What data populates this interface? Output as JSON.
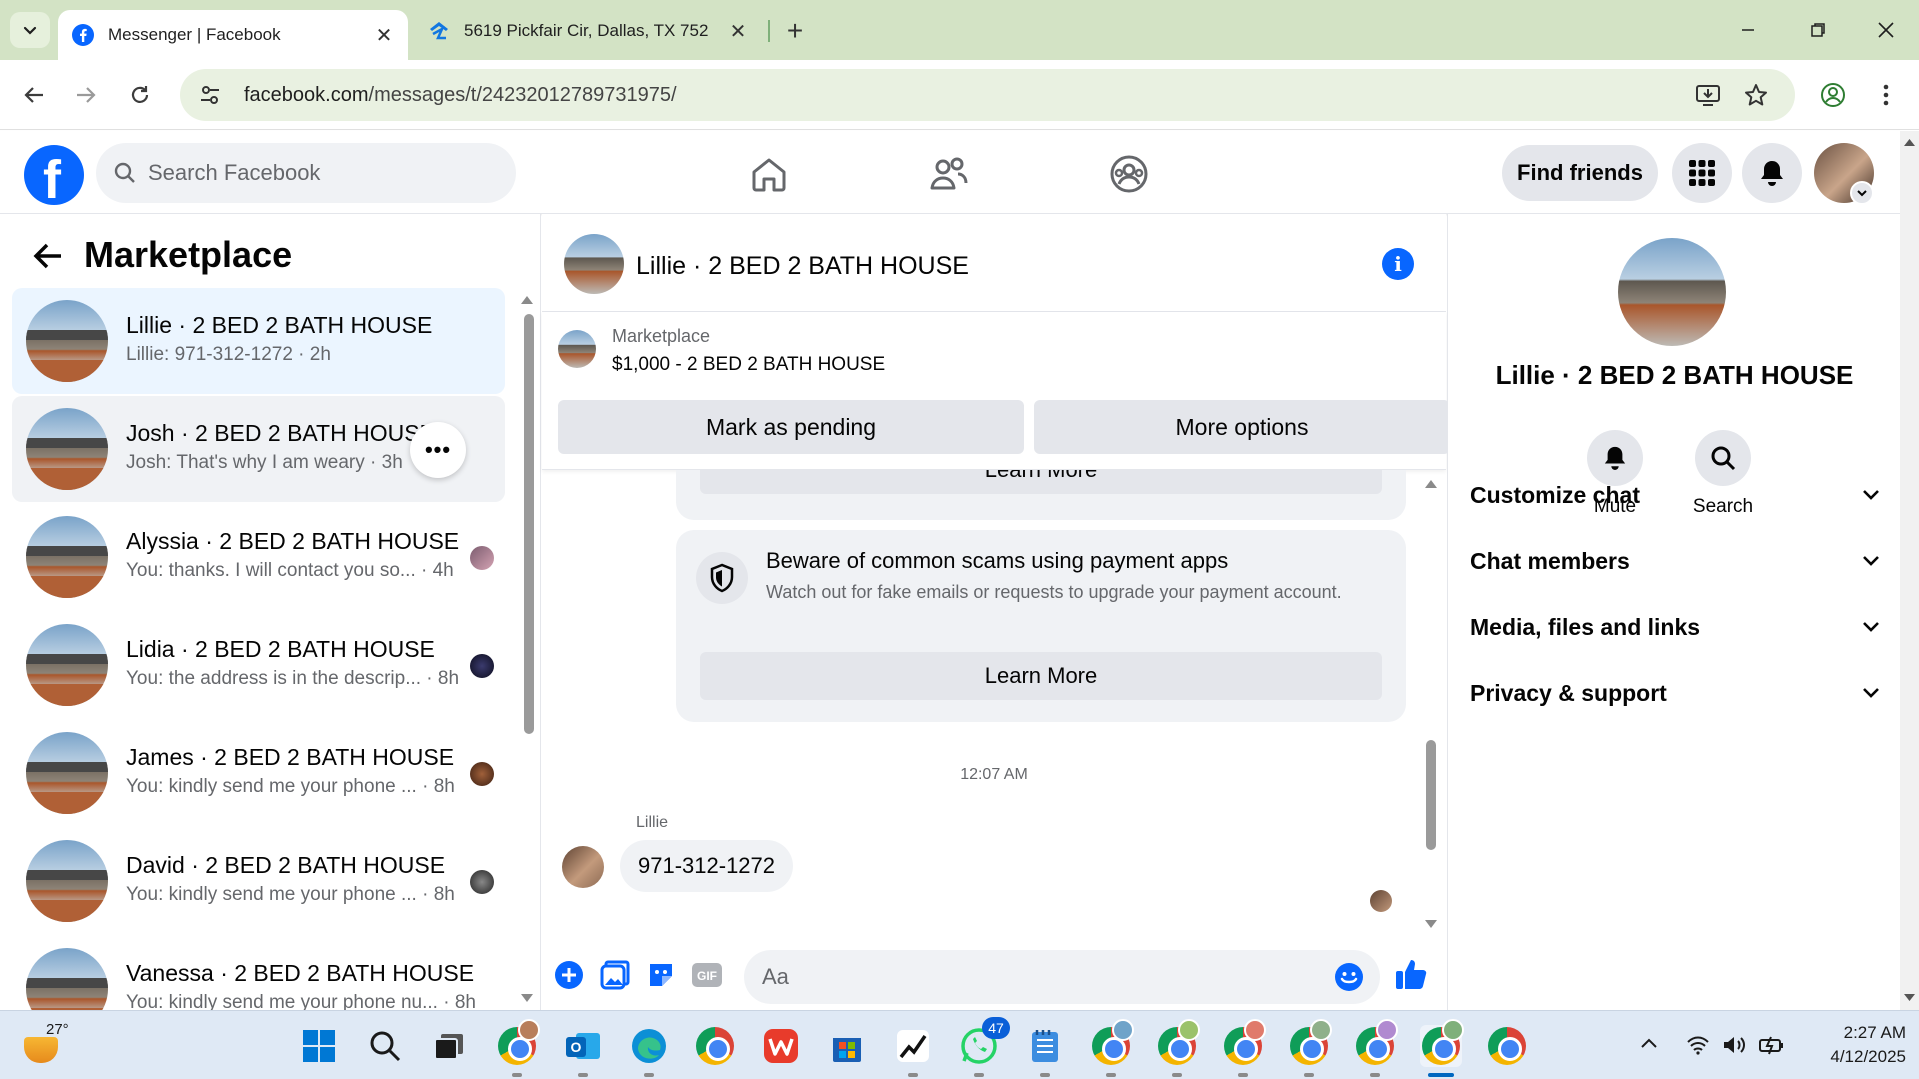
{
  "browser": {
    "tabs": [
      {
        "title": "Messenger | Facebook",
        "icon": "facebook-icon",
        "active": true
      },
      {
        "title": "5619 Pickfair Cir, Dallas, TX 752",
        "icon": "zillow-icon",
        "active": false
      }
    ],
    "url_host": "facebook.com",
    "url_path": "/messages/t/24232012789731975/"
  },
  "fb_header": {
    "search_placeholder": "Search Facebook",
    "find_friends_label": "Find friends"
  },
  "left_panel": {
    "title": "Marketplace",
    "conversations": [
      {
        "name": "Lillie · 2 BED 2 BATH HOUSE",
        "preview": "Lillie: 971-312-1272 · 2h",
        "state": "selected"
      },
      {
        "name": "Josh · 2 BED 2 BATH HOUSE",
        "preview": "Josh: That's why I am weary · 3h",
        "state": "hovered"
      },
      {
        "name": "Alyssia · 2 BED 2 BATH HOUSE",
        "preview": "You: thanks. I will contact you so... · 4h"
      },
      {
        "name": "Lidia · 2 BED 2 BATH HOUSE",
        "preview": "You: the address is in the descrip... · 8h"
      },
      {
        "name": "James · 2 BED 2 BATH HOUSE",
        "preview": "You: kindly send me your phone ... · 8h"
      },
      {
        "name": "David · 2 BED 2 BATH HOUSE",
        "preview": "You: kindly send me your phone ... · 8h"
      },
      {
        "name": "Vanessa · 2 BED 2 BATH HOUSE",
        "preview": "You: kindly send me your phone nu... · 8h"
      }
    ],
    "more_label": "•••"
  },
  "chat": {
    "title": "Lillie · 2 BED 2 BATH HOUSE",
    "marketplace_label": "Marketplace",
    "listing": "$1,000 - 2 BED 2 BATH HOUSE",
    "mark_pending_label": "Mark as pending",
    "more_options_label": "More options",
    "learn_more_label": "Learn More",
    "scam_title": "Beware of common scams using payment apps",
    "scam_desc": "Watch out for fake emails or requests to upgrade your payment account.",
    "timestamp": "12:07 AM",
    "sender": "Lillie",
    "message": "971-312-1272",
    "composer_placeholder": "Aa"
  },
  "right_panel": {
    "name": "Lillie · 2 BED 2 BATH HOUSE",
    "mute_label": "Mute",
    "search_label": "Search",
    "sections": [
      "Customize chat",
      "Chat members",
      "Media, files and links",
      "Privacy & support"
    ]
  },
  "taskbar": {
    "temperature": "27°",
    "whatsapp_badge": "47",
    "time": "2:27 AM",
    "date": "4/12/2025"
  },
  "colors": {
    "fb_blue": "#0866ff",
    "chrome_tab_bar": "#d3e3c5",
    "selected_conv": "#ebf5ff"
  }
}
